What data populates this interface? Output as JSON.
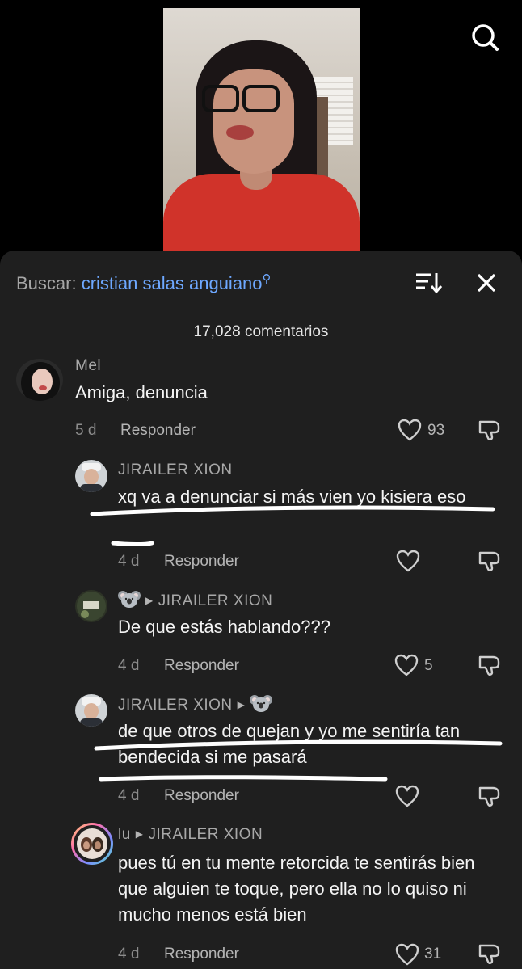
{
  "search": {
    "label": "Buscar:",
    "query": "cristian salas anguiano"
  },
  "comments_count": "17,028 comentarios",
  "comments": [
    {
      "user": "Mel",
      "text": "Amiga, denuncia",
      "time": "5 d",
      "reply": "Responder",
      "likes": "93"
    },
    {
      "user": "JIRAILER XION",
      "text": "xq va a denunciar si más vien yo kisiera eso",
      "time": "4 d",
      "reply": "Responder",
      "likes": ""
    },
    {
      "user": "JIRAILER XION",
      "text": "De que estás hablando???",
      "time": "4 d",
      "reply": "Responder",
      "likes": "5"
    },
    {
      "user": "JIRAILER XION",
      "text": "de que otros de quejan y yo me sentiría tan bendecida si me pasará",
      "time": "4 d",
      "reply": "Responder",
      "likes": ""
    },
    {
      "user": "lu",
      "reply_to": "JIRAILER XION",
      "text": "pues tú en tu mente retorcida te sentirás bien que alguien te toque, pero ella no lo quiso ni mucho menos está bien",
      "time": "4 d",
      "reply": "Responder",
      "likes": "31"
    }
  ],
  "colors": {
    "sheet_bg": "#1f1f1f",
    "link": "#6ea8ff"
  },
  "icons": [
    "search-icon",
    "sort-icon",
    "close-icon",
    "heart-icon",
    "dislike-icon",
    "koala-emoji-icon"
  ]
}
